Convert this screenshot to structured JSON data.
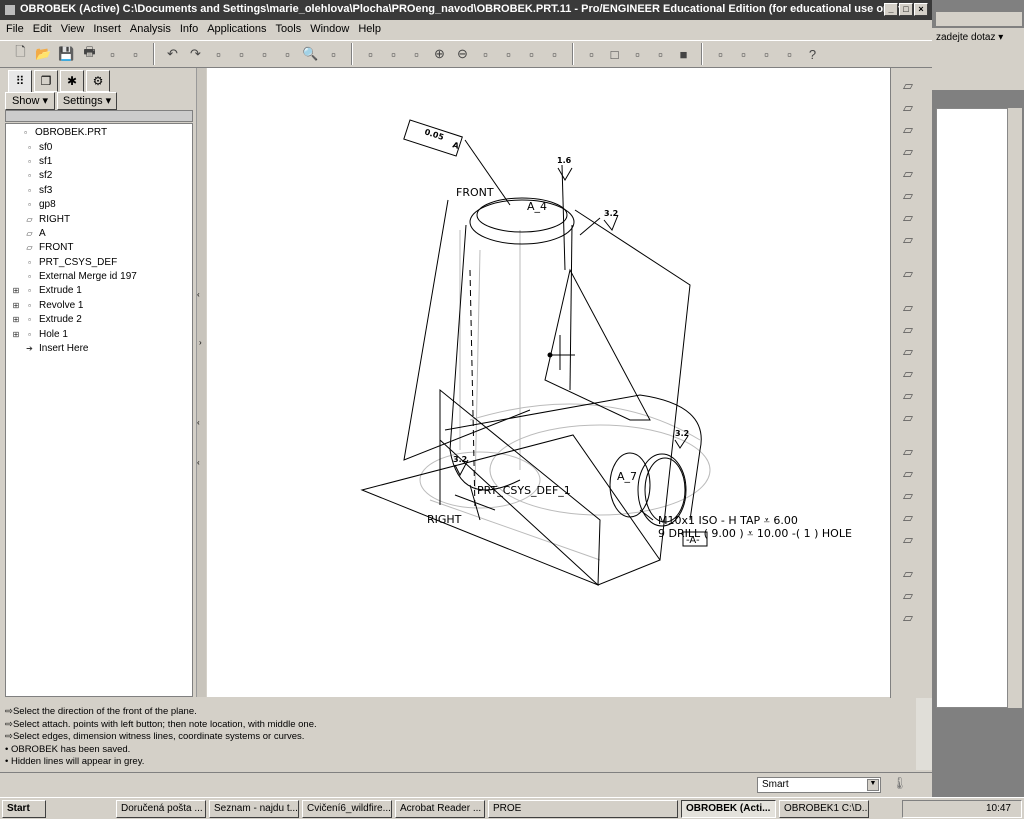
{
  "window": {
    "title": "OBROBEK (Active) C:\\Documents and Settings\\marie_olehlova\\Plocha\\PROeng_navod\\OBROBEK.PRT.11 - Pro/ENGINEER Educational Edition (for educational use only)",
    "min": "_",
    "max": "□",
    "close": "×"
  },
  "menu": [
    "File",
    "Edit",
    "View",
    "Insert",
    "Analysis",
    "Info",
    "Applications",
    "Tools",
    "Window",
    "Help"
  ],
  "toolbar_icons": [
    "new-icon",
    "open-icon",
    "save-icon",
    "print-icon",
    "send-icon",
    "email-icon",
    "undo-icon",
    "redo-icon",
    "copy-icon",
    "paste-icon",
    "paste-special-icon",
    "regenerate-icon",
    "find-icon",
    "selection-box-icon",
    "repaint-icon",
    "spin-center-icon",
    "orient-icon",
    "zoom-in-icon",
    "zoom-out-icon",
    "refit-icon",
    "reorient-icon",
    "saved-views-icon",
    "layers-icon",
    "model-display-icon",
    "wireframe-icon",
    "hidden-line-icon",
    "no-hidden-icon",
    "shading-icon",
    "datum-planes-icon",
    "datum-axes-icon",
    "datum-points-icon",
    "csys-icon",
    "help-icon"
  ],
  "left_panel": {
    "tabs": [
      "model-tree-icon",
      "folder-browser-icon",
      "favorites-icon",
      "connections-icon"
    ],
    "show_label": "Show",
    "settings_label": "Settings",
    "tree": [
      {
        "label": "OBROBEK.PRT",
        "icon": "part-icon",
        "expand": false,
        "indent": 0
      },
      {
        "label": "sf0",
        "icon": "surface-finish-icon",
        "indent": 1
      },
      {
        "label": "sf1",
        "icon": "surface-finish-icon",
        "indent": 1
      },
      {
        "label": "sf2",
        "icon": "surface-finish-icon",
        "indent": 1
      },
      {
        "label": "sf3",
        "icon": "surface-finish-icon",
        "indent": 1
      },
      {
        "label": "gp8",
        "icon": "geometric-tolerance-icon",
        "indent": 1
      },
      {
        "label": "RIGHT",
        "icon": "datum-plane-icon",
        "indent": 1
      },
      {
        "label": "A",
        "icon": "datum-plane-icon",
        "indent": 1
      },
      {
        "label": "FRONT",
        "icon": "datum-plane-icon",
        "indent": 1
      },
      {
        "label": "PRT_CSYS_DEF",
        "icon": "csys-icon",
        "indent": 1
      },
      {
        "label": "External Merge id 197",
        "icon": "merge-icon",
        "indent": 1
      },
      {
        "label": "Extrude 1",
        "icon": "extrude-icon",
        "expand": true,
        "indent": 1
      },
      {
        "label": "Revolve 1",
        "icon": "revolve-icon",
        "expand": true,
        "indent": 1
      },
      {
        "label": "Extrude 2",
        "icon": "extrude-icon",
        "expand": true,
        "indent": 1
      },
      {
        "label": "Hole 1",
        "icon": "hole-icon",
        "expand": true,
        "indent": 1
      },
      {
        "label": "Insert Here",
        "icon": "insert-arrow-icon",
        "indent": 1
      }
    ]
  },
  "drawing": {
    "tolerance": "0.05",
    "datum_ref": "A",
    "front": "FRONT",
    "a4": "A_4",
    "sf_top": "1.6",
    "sf_right": "3.2",
    "sf_cyl": "3.2",
    "sf_bottom": "3.2",
    "csys": "PRT_CSYS_DEF_1",
    "right": "RIGHT",
    "a7": "A_7",
    "hole_line1": "M10x1 ISO - H TAP ⩡ 6.00",
    "hole_line2": "9 DRILL ( 9.00 ) ⩡ 10.00 -( 1 ) HOLE",
    "datum_box": "-A-"
  },
  "messages": [
    {
      "icon": "prompt-arrow-icon",
      "text": "Select the direction of the front of the plane."
    },
    {
      "icon": "prompt-arrow-icon",
      "text": "Select attach. points with left button; then note location, with middle one."
    },
    {
      "icon": "prompt-arrow-icon",
      "text": "Select edges, dimension witness lines, coordinate systems or curves."
    },
    {
      "icon": "bullet-icon",
      "text": "OBROBEK has been saved."
    },
    {
      "icon": "bullet-icon",
      "text": "Hidden lines will appear in grey."
    }
  ],
  "status": {
    "filter": "Smart"
  },
  "bg_window": {
    "search": "zadejte dotaz"
  },
  "taskbar": {
    "start": "Start",
    "tasks": [
      "Doručená pošta ...",
      "Seznam - najdu t...",
      "Cvičení6_wildfire...",
      "Acrobat Reader ...",
      "PROE",
      "OBROBEK (Acti...",
      "OBROBEK1 C:\\D..."
    ],
    "active_index": 5,
    "clock": "10:47"
  }
}
